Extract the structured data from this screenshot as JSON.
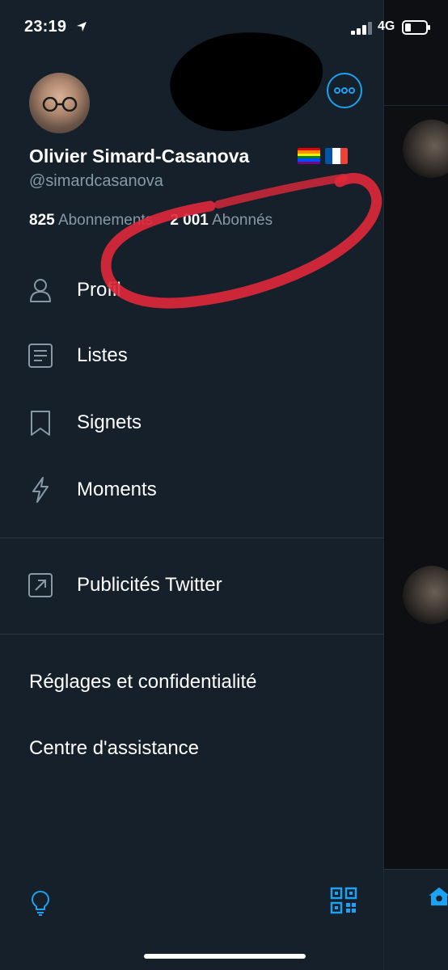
{
  "status_bar": {
    "time": "23:19",
    "network": "4G"
  },
  "profile": {
    "name": "Olivier Simard-Casanova",
    "handle": "@simardcasanova",
    "following_count": "825",
    "following_label": "Abonnements",
    "followers_count": "2 001",
    "followers_label": "Abonnés"
  },
  "menu": {
    "items": [
      {
        "label": "Profil",
        "icon": "person-icon"
      },
      {
        "label": "Listes",
        "icon": "list-icon"
      },
      {
        "label": "Signets",
        "icon": "bookmark-icon"
      },
      {
        "label": "Moments",
        "icon": "lightning-icon"
      }
    ],
    "ads": {
      "label": "Publicités Twitter",
      "icon": "external-link-icon"
    },
    "settings_label": "Réglages et confidentialité",
    "help_label": "Centre d'assistance"
  },
  "colors": {
    "accent": "#1da1f2",
    "background": "#15202b",
    "muted_text": "#8899a6",
    "annotation_red": "#e0283a"
  }
}
